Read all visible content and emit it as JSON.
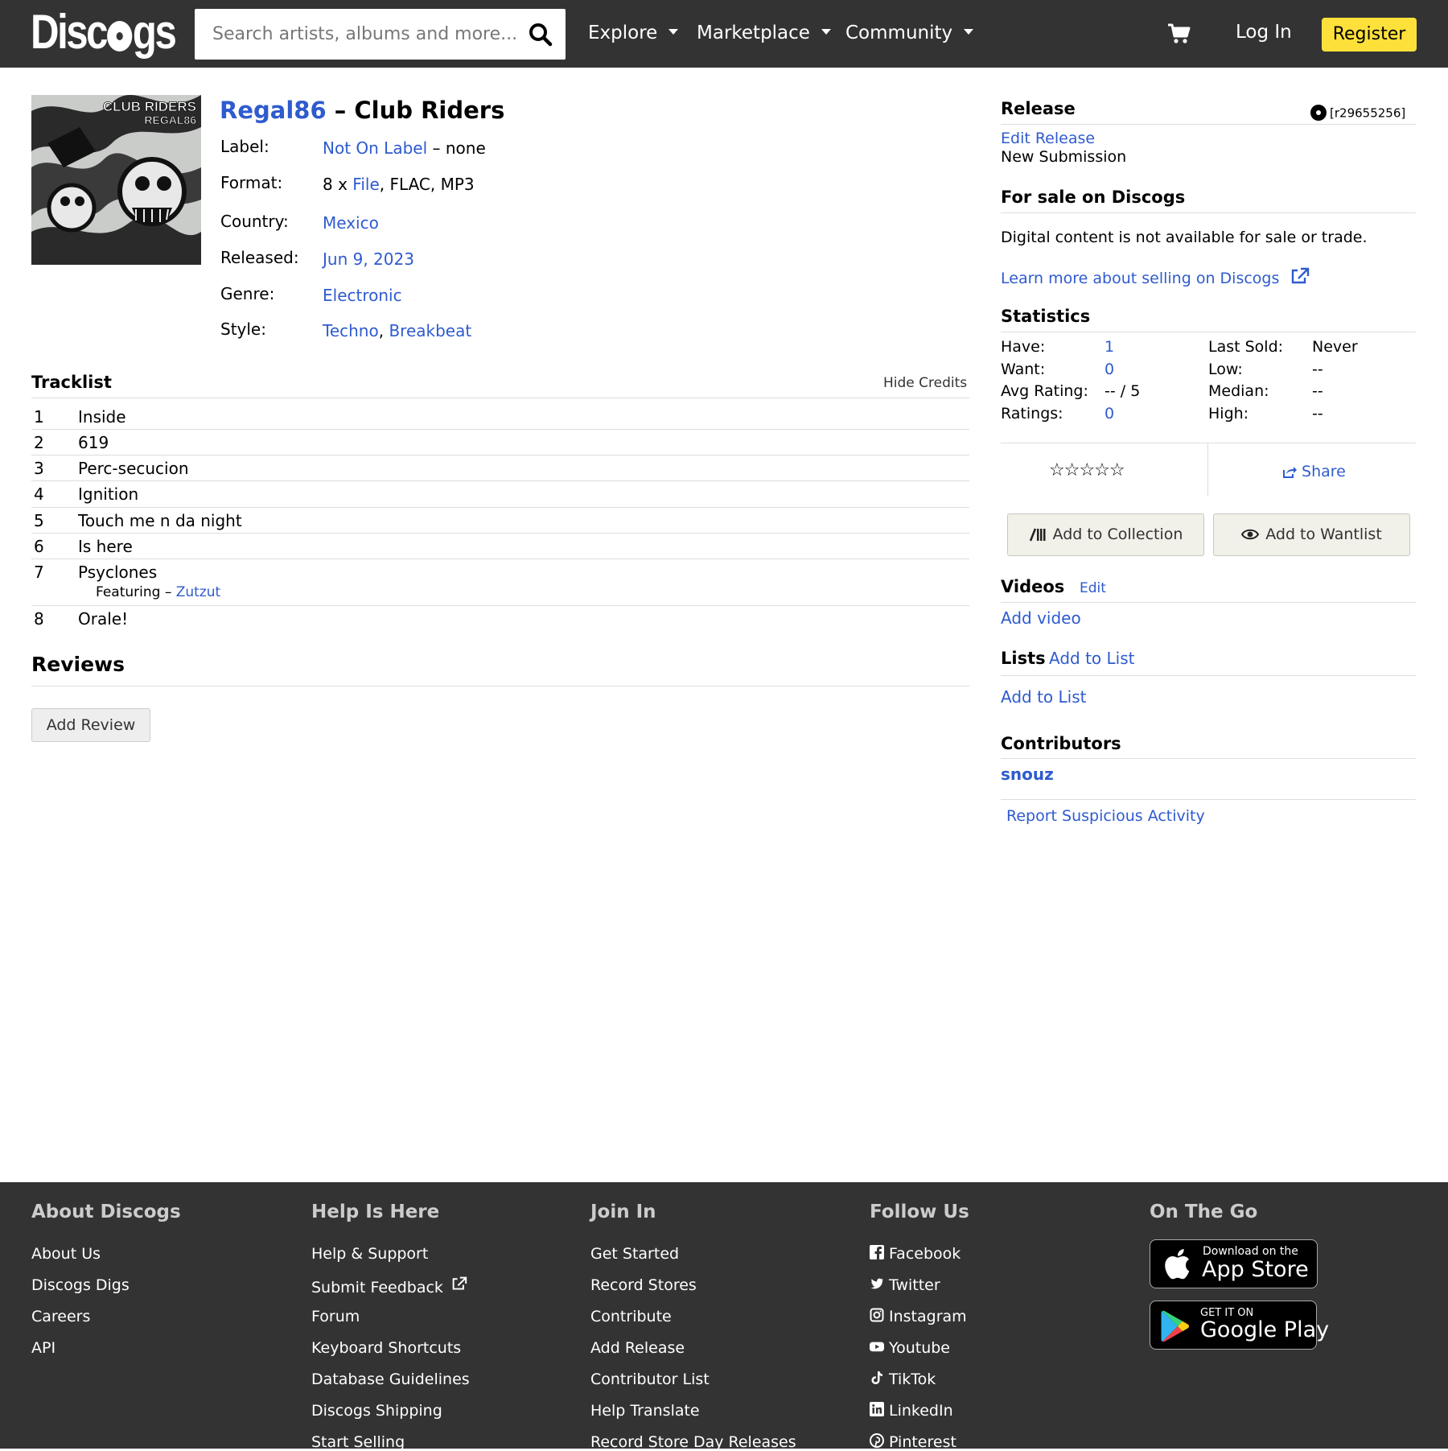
{
  "header": {
    "logo_text": "Discogs",
    "search_placeholder": "Search artists, albums and more...",
    "nav": [
      {
        "label": "Explore"
      },
      {
        "label": "Marketplace"
      },
      {
        "label": "Community"
      }
    ],
    "login_label": "Log In",
    "register_label": "Register"
  },
  "release": {
    "artist": "Regal86",
    "separator": "–",
    "title": "Club Riders",
    "cover_text": "CLUB RIDERS REGAL86",
    "profile": {
      "label_label": "Label:",
      "label_link": "Not On Label",
      "label_rest": "– none",
      "format_label": "Format:",
      "format_pre": "8 x",
      "format_link": "File",
      "format_rest": ", FLAC, MP3",
      "country_label": "Country:",
      "country_value": "Mexico",
      "released_label": "Released:",
      "released_value": "Jun 9, 2023",
      "genre_label": "Genre:",
      "genre_value": "Electronic",
      "style_label": "Style:",
      "style_1": "Techno",
      "style_sep": ",",
      "style_2": "Breakbeat"
    }
  },
  "tracklist": {
    "heading": "Tracklist",
    "hide_credits": "Hide Credits",
    "tracks": [
      {
        "num": "1",
        "title": "Inside"
      },
      {
        "num": "2",
        "title": "619"
      },
      {
        "num": "3",
        "title": "Perc-secucion"
      },
      {
        "num": "4",
        "title": "Ignition"
      },
      {
        "num": "5",
        "title": "Touch me n da night"
      },
      {
        "num": "6",
        "title": "Is here"
      },
      {
        "num": "7",
        "title": "Psyclones"
      },
      {
        "num": "8",
        "title": "Orale!"
      }
    ],
    "credit_role": "Featuring –",
    "credit_artist": "Zutzut"
  },
  "reviews": {
    "heading": "Reviews",
    "add_review": "Add Review"
  },
  "sidebar": {
    "release_heading": "Release",
    "release_id": "[r29655256]",
    "edit_release": "Edit Release",
    "status": "New Submission",
    "for_sale_heading": "For sale on Discogs",
    "for_sale_text": "Digital content is not available for sale or trade.",
    "learn_more": "Learn more about selling on Discogs",
    "statistics_heading": "Statistics",
    "stats": {
      "have_label": "Have:",
      "have_value": "1",
      "want_label": "Want:",
      "want_value": "0",
      "avg_label": "Avg Rating:",
      "avg_value": "-- / 5",
      "ratings_label": "Ratings:",
      "ratings_value": "0",
      "last_sold_label": "Last Sold:",
      "last_sold_value": "Never",
      "low_label": "Low:",
      "low_value": "--",
      "median_label": "Median:",
      "median_value": "--",
      "high_label": "High:",
      "high_value": "--"
    },
    "rating_stars": "☆☆☆☆☆",
    "share_label": "Share",
    "add_collection": "Add to Collection",
    "add_wantlist": "Add to Wantlist",
    "videos_heading": "Videos",
    "videos_edit": "Edit",
    "add_video": "Add video",
    "lists_heading": "Lists",
    "lists_add_inline": "Add to List",
    "lists_add": "Add to List",
    "contributors_heading": "Contributors",
    "contributor": "snouz",
    "report": "Report Suspicious Activity"
  },
  "footer": {
    "columns": [
      {
        "heading": "About Discogs",
        "links": [
          "About Us",
          "Discogs Digs",
          "Careers",
          "API"
        ]
      },
      {
        "heading": "Help Is Here",
        "links": [
          "Help & Support",
          "Submit Feedback",
          "Forum",
          "Keyboard Shortcuts",
          "Database Guidelines",
          "Discogs Shipping",
          "Start Selling"
        ]
      },
      {
        "heading": "Join In",
        "links": [
          "Get Started",
          "Record Stores",
          "Contribute",
          "Add Release",
          "Contributor List",
          "Help Translate",
          "Record Store Day Releases"
        ]
      },
      {
        "heading": "Follow Us",
        "links": [
          "Facebook",
          "Twitter",
          "Instagram",
          "Youtube",
          "TikTok",
          "LinkedIn",
          "Pinterest"
        ]
      },
      {
        "heading": "On The Go"
      }
    ],
    "app_store_small": "Download on the",
    "app_store_big": "App Store",
    "google_small": "GET IT ON",
    "google_big": "Google Play"
  },
  "colors": {
    "header_bg": "#333333",
    "register_bg": "#fde13a",
    "link": "#2e5bce",
    "footer_bg": "#333333"
  },
  "icons": [
    "search-icon",
    "chevron-down-icon",
    "cart-icon",
    "disc-icon",
    "external-link-icon",
    "star-icon",
    "share-icon",
    "collection-icon",
    "eye-icon",
    "facebook-icon",
    "twitter-icon",
    "instagram-icon",
    "youtube-icon",
    "tiktok-icon",
    "linkedin-icon",
    "pinterest-icon",
    "apple-icon",
    "google-play-icon"
  ]
}
